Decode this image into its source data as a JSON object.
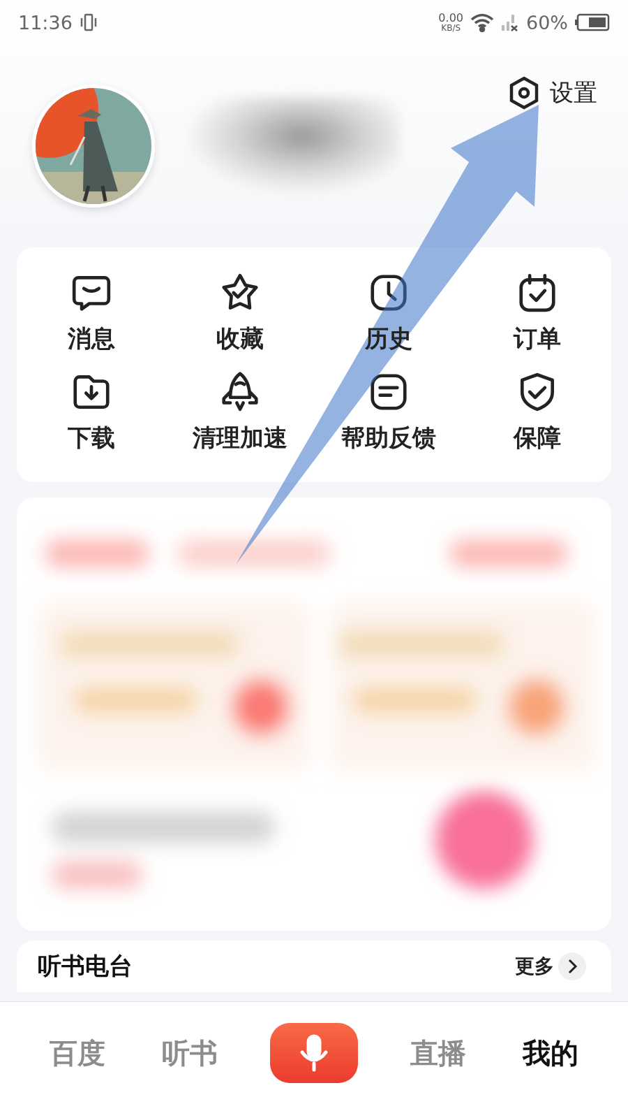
{
  "status_bar": {
    "time": "11:36",
    "net_speed": "0.00",
    "net_unit": "KB/S",
    "battery": "60%"
  },
  "header": {
    "settings_label": "设置"
  },
  "shortcuts": [
    {
      "label": "消息"
    },
    {
      "label": "收藏"
    },
    {
      "label": "历史"
    },
    {
      "label": "订单"
    },
    {
      "label": "下载"
    },
    {
      "label": "清理加速"
    },
    {
      "label": "帮助反馈"
    },
    {
      "label": "保障"
    }
  ],
  "section": {
    "title": "听书电台",
    "more": "更多"
  },
  "tabs": [
    {
      "kind": "text",
      "label": "百度",
      "selected": false
    },
    {
      "kind": "text",
      "label": "听书",
      "selected": false
    },
    {
      "kind": "voice",
      "selected": false
    },
    {
      "kind": "text",
      "label": "直播",
      "selected": false
    },
    {
      "kind": "text",
      "label": "我的",
      "selected": true
    }
  ]
}
